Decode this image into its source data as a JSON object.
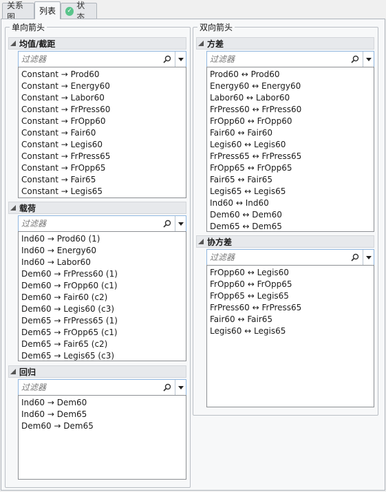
{
  "tabs": [
    {
      "label": "关系图"
    },
    {
      "label": "列表"
    },
    {
      "label": "状态"
    }
  ],
  "left_group": {
    "title": "单向箭头",
    "sections": [
      {
        "title": "均值/截距",
        "filter_placeholder": "过滤器",
        "items": [
          "Constant → Prod60",
          "Constant → Energy60",
          "Constant → Labor60",
          "Constant → FrPress60",
          "Constant → FrOpp60",
          "Constant → Fair60",
          "Constant → Legis60",
          "Constant → FrPress65",
          "Constant → FrOpp65",
          "Constant → Fair65",
          "Constant → Legis65"
        ]
      },
      {
        "title": "载荷",
        "filter_placeholder": "过滤器",
        "items": [
          "Ind60 → Prod60 (1)",
          "Ind60 → Energy60",
          "Ind60 → Labor60",
          "Dem60 → FrPress60 (1)",
          "Dem60 → FrOpp60 (c1)",
          "Dem60 → Fair60 (c2)",
          "Dem60 → Legis60 (c3)",
          "Dem65 → FrPress65 (1)",
          "Dem65 → FrOpp65 (c1)",
          "Dem65 → Fair65 (c2)",
          "Dem65 → Legis65 (c3)"
        ]
      },
      {
        "title": "回归",
        "filter_placeholder": "过滤器",
        "items": [
          "Ind60 → Dem60",
          "Ind60 → Dem65",
          "Dem60 → Dem65"
        ]
      }
    ]
  },
  "right_group": {
    "title": "双向箭头",
    "sections": [
      {
        "title": "方差",
        "filter_placeholder": "过滤器",
        "items": [
          "Prod60 ↔ Prod60",
          "Energy60 ↔ Energy60",
          "Labor60 ↔ Labor60",
          "FrPress60 ↔ FrPress60",
          "FrOpp60 ↔ FrOpp60",
          "Fair60 ↔ Fair60",
          "Legis60 ↔ Legis60",
          "FrPress65 ↔ FrPress65",
          "FrOpp65 ↔ FrOpp65",
          "Fair65 ↔ Fair65",
          "Legis65 ↔ Legis65",
          "Ind60 ↔ Ind60",
          "Dem60 ↔ Dem60",
          "Dem65 ↔ Dem65"
        ]
      },
      {
        "title": "协方差",
        "filter_placeholder": "过滤器",
        "items": [
          "FrOpp60 ↔ Legis60",
          "FrOpp60 ↔ FrOpp65",
          "FrOpp65 ↔ Legis65",
          "FrPress60 ↔ FrPress65",
          "Fair60 ↔ Fair65",
          "Legis60 ↔ Legis65"
        ]
      }
    ]
  }
}
